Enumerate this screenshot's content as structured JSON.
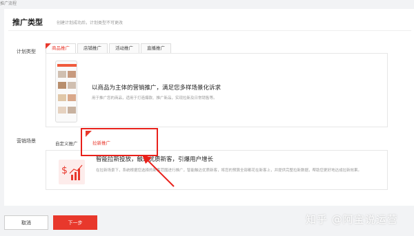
{
  "breadcrumb": "推广流程",
  "section": {
    "title": "推广类型",
    "subtitle": "创建计划成功后，计划类型不可更改"
  },
  "plan_type": {
    "label": "计划类型",
    "tabs": [
      "商品推广",
      "店铺推广",
      "活动推广",
      "直播推广"
    ],
    "active_tab": "商品推广",
    "headline": "以商品为主体的营销推广，满足您多样场景化诉求",
    "description": "用于推广您的商品，适用于打造爆款、推广新品，实现拉新及日常销售等。"
  },
  "marketing_scene": {
    "label": "营销场景",
    "tabs": [
      "自定义推广",
      "拉新推广"
    ],
    "active_tab": "拉新推广",
    "headline": "智能拉新投放，触达优质新客，引爆用户增长",
    "description": "在拉新场景下，系统根据您选择的新客范围进行推广，智能触达优质新客，将您的预算全部都花在新客上，并提供完整拉新数据，帮助您更好地达成拉新效果。"
  },
  "buttons": {
    "cancel": "取消",
    "next": "下一步"
  },
  "watermark": "知乎 @阿宝说运营",
  "colors": {
    "accent": "#e8382c",
    "annotation": "#e8201a"
  }
}
